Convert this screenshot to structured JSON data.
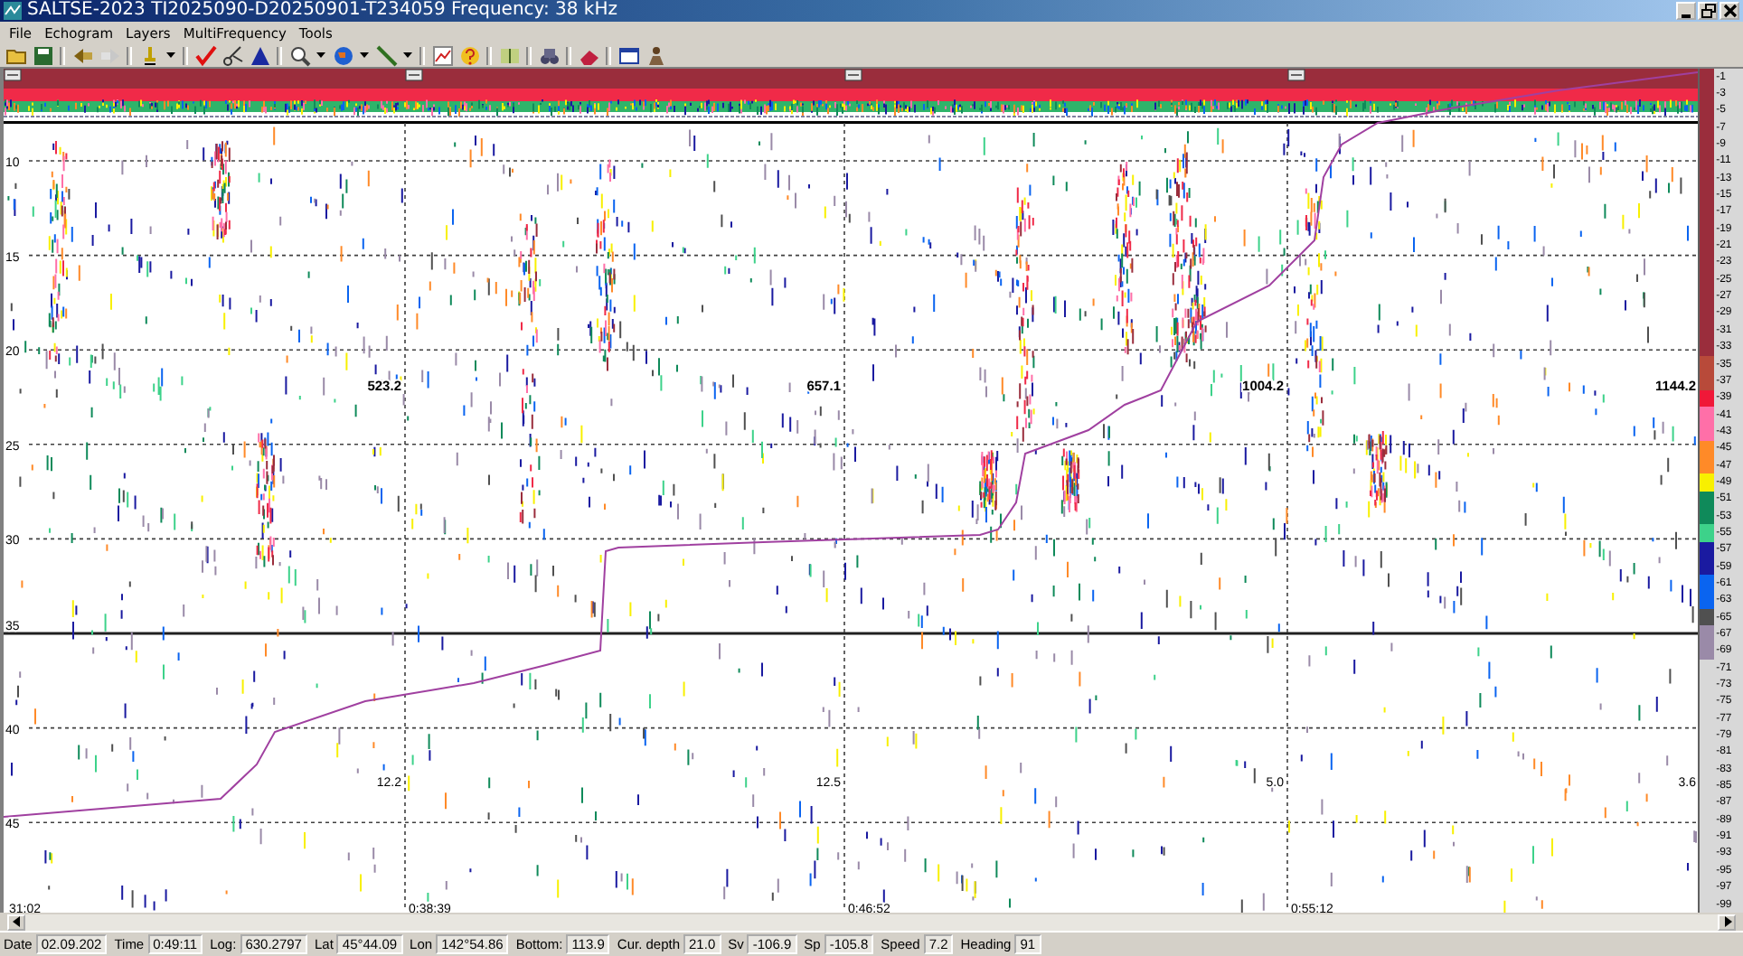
{
  "window": {
    "title": "SALTSE-2023  TI2025090-D20250901-T234059  Frequency: 38 kHz"
  },
  "menu": [
    "File",
    "Echogram",
    "Layers",
    "MultiFrequency",
    "Tools"
  ],
  "echogram": {
    "depth_labels": [
      "10",
      "15",
      "20",
      "25",
      "30",
      "35",
      "40",
      "45"
    ],
    "log_labels": [
      "523.2",
      "657.1",
      "1004.2",
      "1144.2"
    ],
    "value_labels": [
      "12.2",
      "12.5",
      "5.0",
      "3.6"
    ],
    "time_labels": [
      "31:02",
      "0:38:39",
      "0:46:52",
      "0:55:12"
    ]
  },
  "color_scale": [
    {
      "label": "-1",
      "color": "#9a2d3c"
    },
    {
      "label": "-3",
      "color": "#9a2d3c"
    },
    {
      "label": "-5",
      "color": "#9a2d3c"
    },
    {
      "label": "-7",
      "color": "#9a2d3c"
    },
    {
      "label": "-9",
      "color": "#9a2d3c"
    },
    {
      "label": "-11",
      "color": "#9a2d3c"
    },
    {
      "label": "-13",
      "color": "#9a2d3c"
    },
    {
      "label": "-15",
      "color": "#9a2d3c"
    },
    {
      "label": "-17",
      "color": "#9a2d3c"
    },
    {
      "label": "-19",
      "color": "#9a2d3c"
    },
    {
      "label": "-21",
      "color": "#9a2d3c"
    },
    {
      "label": "-23",
      "color": "#9a2d3c"
    },
    {
      "label": "-25",
      "color": "#9a2d3c"
    },
    {
      "label": "-27",
      "color": "#9a2d3c"
    },
    {
      "label": "-29",
      "color": "#9a2d3c"
    },
    {
      "label": "-31",
      "color": "#9a2d3c"
    },
    {
      "label": "-33",
      "color": "#9a2d3c"
    },
    {
      "label": "-35",
      "color": "#b84a3a"
    },
    {
      "label": "-37",
      "color": "#b84a3a"
    },
    {
      "label": "-39",
      "color": "#f01838"
    },
    {
      "label": "-41",
      "color": "#ff6fa8"
    },
    {
      "label": "-43",
      "color": "#ff6fa8"
    },
    {
      "label": "-45",
      "color": "#ff8a28"
    },
    {
      "label": "-47",
      "color": "#ff8a28"
    },
    {
      "label": "-49",
      "color": "#f8f000"
    },
    {
      "label": "-51",
      "color": "#0f8a5a"
    },
    {
      "label": "-53",
      "color": "#0f8a5a"
    },
    {
      "label": "-55",
      "color": "#3dd28a"
    },
    {
      "label": "-57",
      "color": "#1a1aa0"
    },
    {
      "label": "-59",
      "color": "#1a1aa0"
    },
    {
      "label": "-61",
      "color": "#0a64f0"
    },
    {
      "label": "-63",
      "color": "#0a64f0"
    },
    {
      "label": "-65",
      "color": "#505050"
    },
    {
      "label": "-67",
      "color": "#9a8aa8"
    },
    {
      "label": "-69",
      "color": "#9a8aa8"
    },
    {
      "label": "-71"
    },
    {
      "label": "-73"
    },
    {
      "label": "-75"
    },
    {
      "label": "-77"
    },
    {
      "label": "-79"
    },
    {
      "label": "-81"
    },
    {
      "label": "-83"
    },
    {
      "label": "-85"
    },
    {
      "label": "-87"
    },
    {
      "label": "-89"
    },
    {
      "label": "-91"
    },
    {
      "label": "-93"
    },
    {
      "label": "-95"
    },
    {
      "label": "-97"
    },
    {
      "label": "-99"
    }
  ],
  "status_bar": [
    {
      "label": "Date",
      "value": "02.09.202"
    },
    {
      "label": "Time",
      "value": "0:49:11"
    },
    {
      "label": "Log:",
      "value": "630.2797"
    },
    {
      "label": "Lat",
      "value": "45°44.09"
    },
    {
      "label": "Lon",
      "value": "142°54.86"
    },
    {
      "label": "Bottom:",
      "value": "113.9"
    },
    {
      "label": "Cur. depth",
      "value": "21.0"
    },
    {
      "label": "Sv",
      "value": "-106.9"
    },
    {
      "label": "Sp",
      "value": "-105.8"
    },
    {
      "label": "Speed",
      "value": "7.2"
    },
    {
      "label": "Heading",
      "value": "91"
    }
  ]
}
